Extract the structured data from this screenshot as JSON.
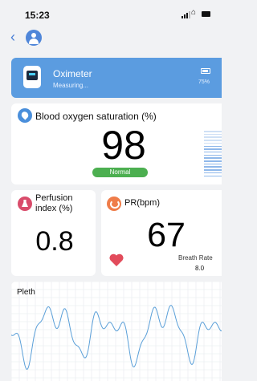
{
  "status_bar": {
    "time": "15:23"
  },
  "header": {
    "back_icon": "chevron-left-icon",
    "avatar_icon": "user-avatar-icon"
  },
  "device": {
    "name": "Oximeter",
    "status": "Measuring...",
    "battery": "75%",
    "icon": "oximeter-device-icon",
    "color": "#5b9ce0"
  },
  "spo2": {
    "title": "Blood oxygen saturation (%)",
    "value": "98",
    "badge": "Normal",
    "icon": "blood-drop-icon",
    "badge_color": "#4caf50"
  },
  "perfusion": {
    "title": "Perfusion index (%)",
    "value": "0.8",
    "icon": "flask-icon",
    "icon_color": "#d94c6b"
  },
  "pr": {
    "title": "PR(bpm)",
    "value": "67",
    "breath_label": "Breath Rate",
    "breath_value": "8.0",
    "icon": "pulse-icon",
    "heart_icon": "heart-icon",
    "icon_color": "#ef7d4a",
    "heart_color": "#e24b5b"
  },
  "pleth": {
    "title": "Pleth",
    "waveform_color": "#5a9fd8"
  }
}
